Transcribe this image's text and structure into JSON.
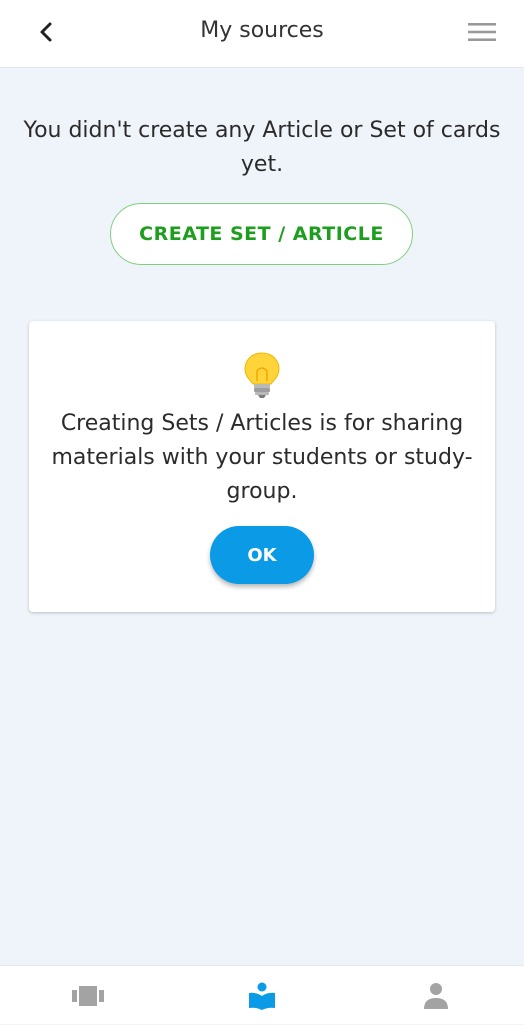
{
  "header": {
    "title": "My sources",
    "back_icon": "chevron-left-icon",
    "menu_icon": "hamburger-menu-icon"
  },
  "main": {
    "empty_message": "You didn't create any Article or Set of cards yet.",
    "create_button_label": "CREATE SET / ARTICLE"
  },
  "tip_card": {
    "icon": "lightbulb-icon",
    "text": "Creating Sets / Articles is for sharing materials with your students or study-group.",
    "ok_label": "OK"
  },
  "bottom_nav": {
    "items": [
      {
        "icon": "cards-stack-icon",
        "active": false
      },
      {
        "icon": "reading-book-icon",
        "active": true
      },
      {
        "icon": "person-icon",
        "active": false
      }
    ]
  },
  "colors": {
    "accent_green": "#1e9e1e",
    "ok_blue": "#0a9ae6",
    "background": "#eff4fb",
    "nav_active": "#0a9ae6",
    "nav_inactive": "#a3a3a3"
  }
}
